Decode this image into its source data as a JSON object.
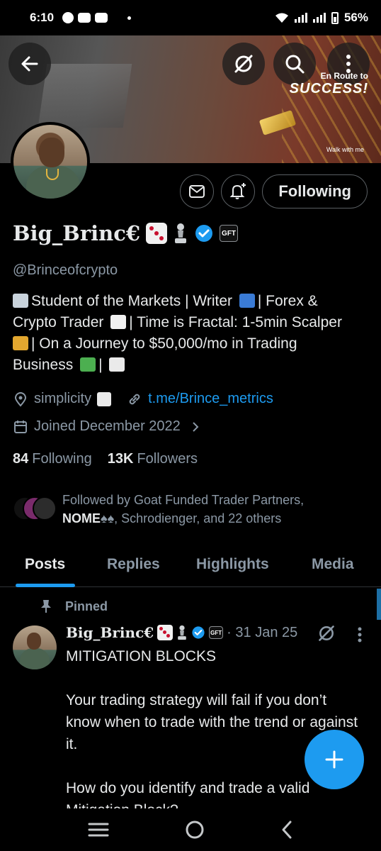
{
  "status_bar": {
    "time": "6:10",
    "battery": "56%"
  },
  "banner": {
    "tagline_small": "En Route to",
    "tagline_big": "SUCCESS!",
    "signature": "Walk with me"
  },
  "profile": {
    "display_name": "Big_Brinc€",
    "handle": "@Brinceofcrypto",
    "affiliate_badge": "GFT",
    "following_button": "Following",
    "bio": {
      "l1a": "Student of the Markets | Writer",
      "l1b": "| Forex &",
      "l2a": "Crypto Trader",
      "l2b": "| Time is Fractal: 1-5min Scalper",
      "l3": "| On a Journey to $50,000/mo in Trading",
      "l4": "Business"
    },
    "location": "simplicity",
    "website": "t.me/Brince_metrics",
    "joined": "Joined December 2022",
    "following_count": "84",
    "following_label": "Following",
    "followers_count": "13K",
    "followers_label": "Followers",
    "followed_by_prefix": "Followed by Goat Funded Trader Partners,",
    "followed_by_bold": "NOME",
    "followed_by_suffix": ", Schrodienger, and 22 others"
  },
  "tabs": [
    {
      "label": "Posts",
      "active": true
    },
    {
      "label": "Replies",
      "active": false
    },
    {
      "label": "Highlights",
      "active": false
    },
    {
      "label": "Media",
      "active": false
    }
  ],
  "pinned_post": {
    "pinned_label": "Pinned",
    "author": "Big_Brinc€",
    "badge": "GFT",
    "date": "· 31 Jan 25",
    "body": "MITIGATION BLOCKS\n\nYour trading strategy will fail if you don’t know when to trade with the trend or against it.\n\nHow do you identify and trade a valid Mitigation Block?"
  },
  "colors": {
    "accent": "#1d9bf0",
    "muted": "#8b98a5",
    "text": "#e7e9ea",
    "background": "#000000"
  },
  "icons": [
    "back-arrow-icon",
    "grok-icon",
    "search-icon",
    "more-vert-icon",
    "mail-icon",
    "bell-plus-icon",
    "verified-icon",
    "location-icon",
    "link-icon",
    "calendar-icon",
    "chevron-right-icon",
    "pin-icon",
    "compose-plus-icon",
    "nav-menu-icon",
    "nav-home-icon",
    "nav-back-icon"
  ]
}
